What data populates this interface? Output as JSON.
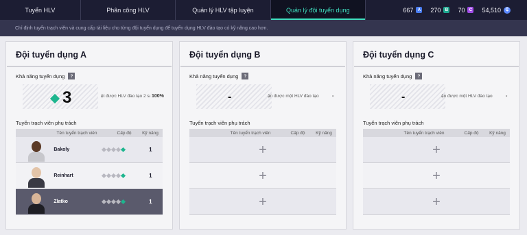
{
  "nav": {
    "tabs": [
      {
        "label": "Tuyển HLV"
      },
      {
        "label": "Phân công HLV"
      },
      {
        "label": "Quản lý HLV tập luyện"
      },
      {
        "label": "Quản lý đội tuyển dụng"
      }
    ],
    "active_tab": 3
  },
  "currencies": [
    {
      "value": "667",
      "badge": "A",
      "color": "#4a7df0"
    },
    {
      "value": "270",
      "badge": "B",
      "color": "#1fa890"
    },
    {
      "value": "70",
      "badge": "C",
      "color": "#a24de8"
    },
    {
      "value": "54,510",
      "badge": "₵",
      "color": "#5a88ff"
    }
  ],
  "subtitle": "Chỉ định tuyển trạch viên và cung cấp tài liệu cho từng đội tuyển dụng để tuyển dụng HLV đào tạo có kỹ năng cao hơn.",
  "colors": {
    "accent": "#3fe0c0",
    "diamond_on": "#1db58e"
  },
  "teams": [
    {
      "title": "Đội tuyển dụng A",
      "ability_label": "Khả năng tuyển dụng",
      "help": "?",
      "ability_value": "3",
      "desc": "ệt được HLV đào tạo 2 sao",
      "desc_value": "100%",
      "coaches_label": "Tuyển trạch viên phụ trách",
      "columns": {
        "name": "Tên tuyển trạch viên",
        "level": "Cấp độ",
        "skill": "Kỹ năng"
      },
      "rows": [
        {
          "name": "Bakoly",
          "level": 1,
          "skill": "1"
        },
        {
          "name": "Reinhart",
          "level": 1,
          "skill": "1"
        },
        {
          "name": "Zlatko",
          "level": 1,
          "skill": "1"
        }
      ]
    },
    {
      "title": "Đội tuyển dụng B",
      "ability_label": "Khả năng tuyển dụng",
      "help": "?",
      "ability_value": "-",
      "desc": "ận được một HLV đào tạo",
      "desc_value": "-",
      "coaches_label": "Tuyển trạch viên phụ trách",
      "columns": {
        "name": "Tên tuyển trạch viên",
        "level": "Cấp độ",
        "skill": "Kỹ năng"
      },
      "empty_slot": "+"
    },
    {
      "title": "Đội tuyển dụng C",
      "ability_label": "Khả năng tuyển dụng",
      "help": "?",
      "ability_value": "-",
      "desc": "ận được một HLV đào tạo",
      "desc_value": "-",
      "coaches_label": "Tuyển trạch viên phụ trách",
      "columns": {
        "name": "Tên tuyển trạch viên",
        "level": "Cấp độ",
        "skill": "Kỹ năng"
      },
      "empty_slot": "+"
    }
  ]
}
